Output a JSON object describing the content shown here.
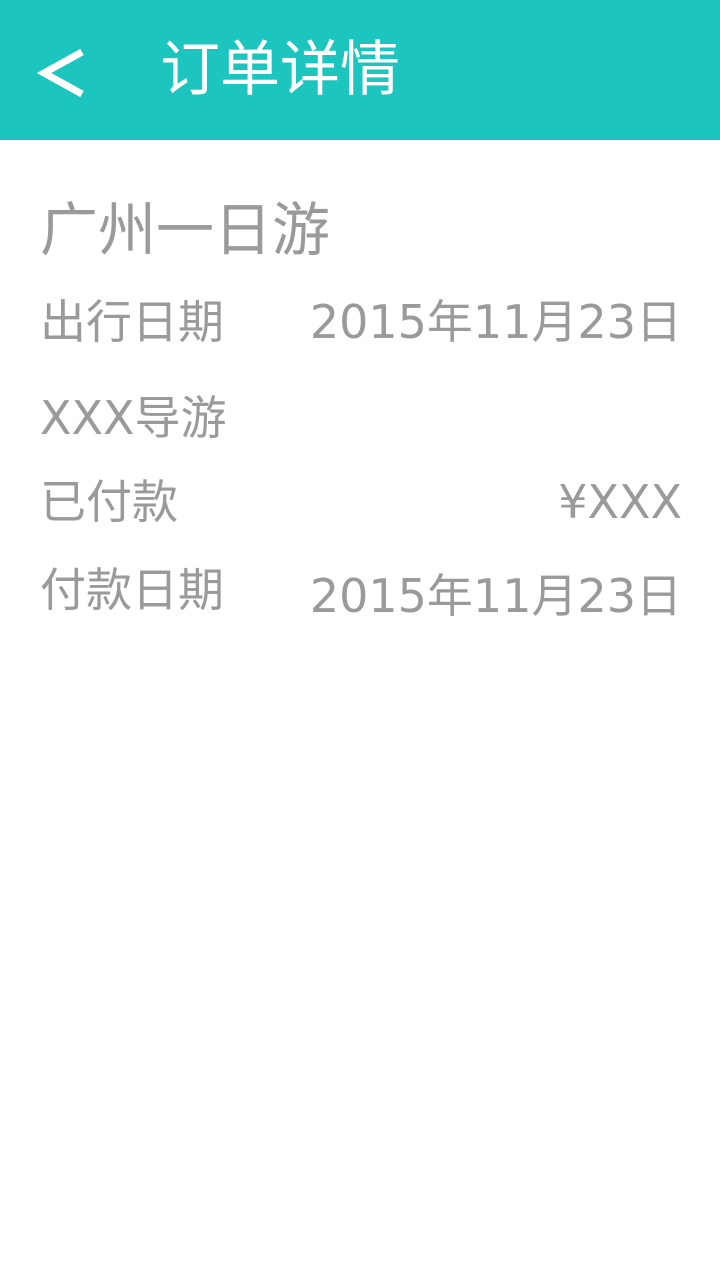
{
  "header": {
    "back_icon": "chevron-left-icon",
    "title": "订单详情",
    "background_color": "#1cc5bd"
  },
  "order": {
    "tour_name": "广州一日游",
    "travel_date_label": "出行日期",
    "travel_date_value": "2015年11月23日",
    "guide_label": "XXX导游",
    "paid_label": "已付款",
    "paid_amount": "¥XXX",
    "payment_date_label": "付款日期",
    "payment_date_value": "2015年11月23日"
  },
  "colors": {
    "text_gray": "#9a9a9a",
    "header_text": "#ffffff"
  }
}
